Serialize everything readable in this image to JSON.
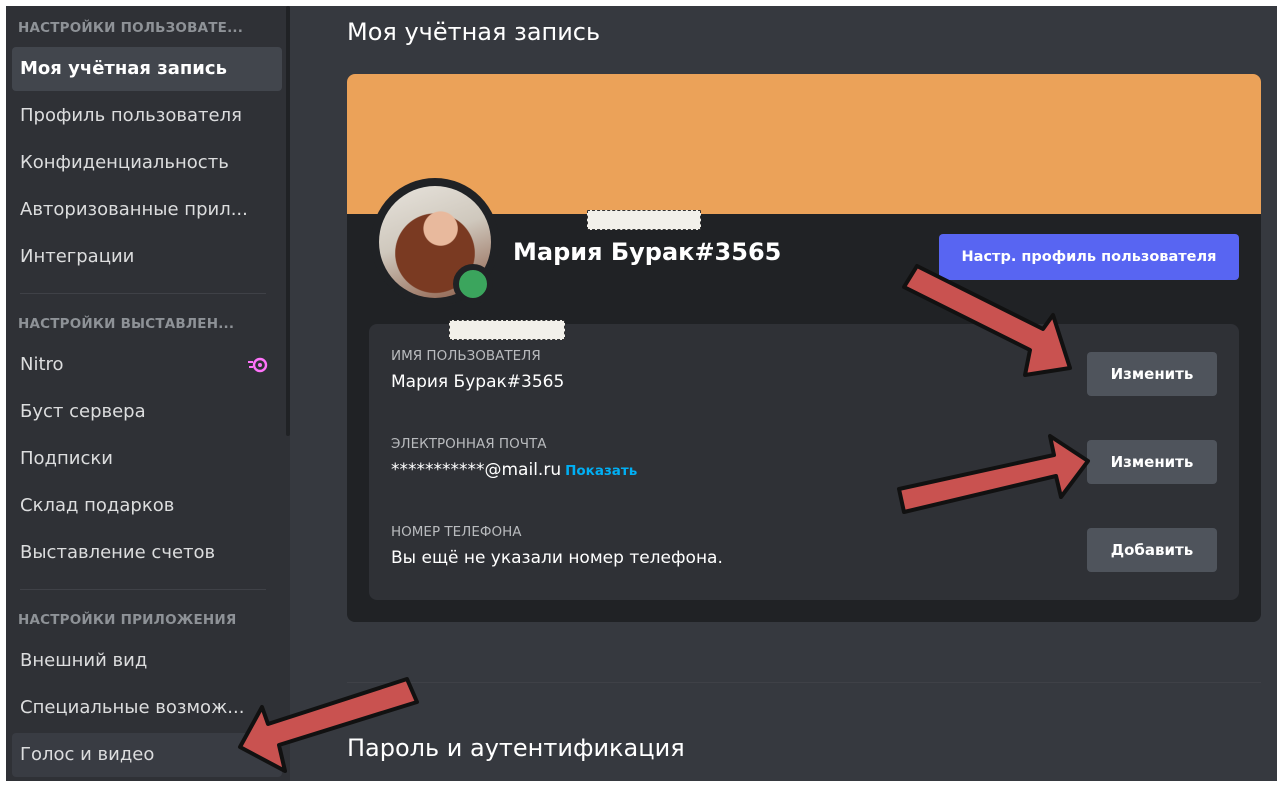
{
  "colors": {
    "banner": "#eba259",
    "accent": "#5865f2",
    "online": "#3ba55d",
    "link": "#00aff4",
    "arrow": "#c95250"
  },
  "sidebar": {
    "section_user": "НАСТРОЙКИ ПОЛЬЗОВАТЕ...",
    "user_items": [
      {
        "label": "Моя учётная запись"
      },
      {
        "label": "Профиль пользователя"
      },
      {
        "label": "Конфиденциальность"
      },
      {
        "label": "Авторизованные прил..."
      },
      {
        "label": "Интеграции"
      }
    ],
    "section_billing": "НАСТРОЙКИ ВЫСТАВЛЕН...",
    "billing_items": [
      {
        "label": "Nitro",
        "icon": "nitro-icon"
      },
      {
        "label": "Буст сервера"
      },
      {
        "label": "Подписки"
      },
      {
        "label": "Склад подарков"
      },
      {
        "label": "Выставление счетов"
      }
    ],
    "section_app": "НАСТРОЙКИ ПРИЛОЖЕНИЯ",
    "app_items": [
      {
        "label": "Внешний вид"
      },
      {
        "label": "Специальные возмож..."
      },
      {
        "label": "Голос и видео"
      }
    ]
  },
  "main": {
    "title": "Моя учётная запись",
    "profile": {
      "username": "Мария Бурак#3565",
      "edit_profile_button": "Настр. профиль пользователя"
    },
    "fields": [
      {
        "label": "ИМЯ ПОЛЬЗОВАТЕЛЯ",
        "value": "Мария Бурак#3565",
        "button": "Изменить"
      },
      {
        "label": "ЭЛЕКТРОННАЯ ПОЧТА",
        "value": "***********@mail.ru",
        "link": "Показать",
        "button": "Изменить"
      },
      {
        "label": "НОМЕР ТЕЛЕФОНА",
        "value": "Вы ещё не указали номер телефона.",
        "button": "Добавить"
      }
    ],
    "password_section_title": "Пароль и аутентификация"
  }
}
